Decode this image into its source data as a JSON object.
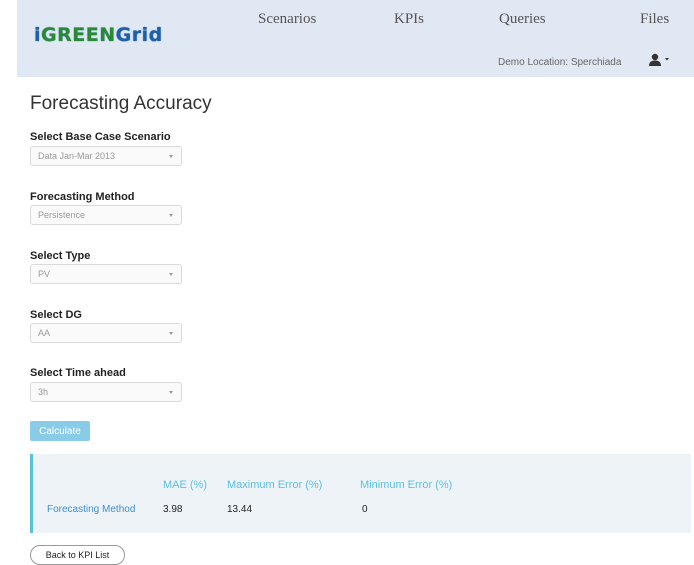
{
  "header": {
    "logo_text": "iGREENGrid",
    "nav": [
      "Scenarios",
      "KPIs",
      "Queries",
      "Files"
    ],
    "location": "Demo Location: Sperchiada",
    "user_icon": "user-icon"
  },
  "page": {
    "title": "Forecasting Accuracy"
  },
  "form": {
    "fields": [
      {
        "label": "Select Base Case Scenario",
        "value": "Data Jan-Mar 2013"
      },
      {
        "label": "Forecasting Method",
        "value": "Persistence"
      },
      {
        "label": "Select Type",
        "value": "PV"
      },
      {
        "label": "Select DG",
        "value": "AA"
      },
      {
        "label": "Select Time ahead",
        "value": "3h"
      }
    ],
    "calculate_label": "Calculate"
  },
  "results": {
    "headers": [
      "MAE (%)",
      "Maximum Error (%)",
      "Minimum Error (%)"
    ],
    "row_label": "Forecasting Method",
    "values": [
      "3.98",
      "13.44",
      "0"
    ]
  },
  "footer": {
    "back_label": "Back to KPI List"
  }
}
